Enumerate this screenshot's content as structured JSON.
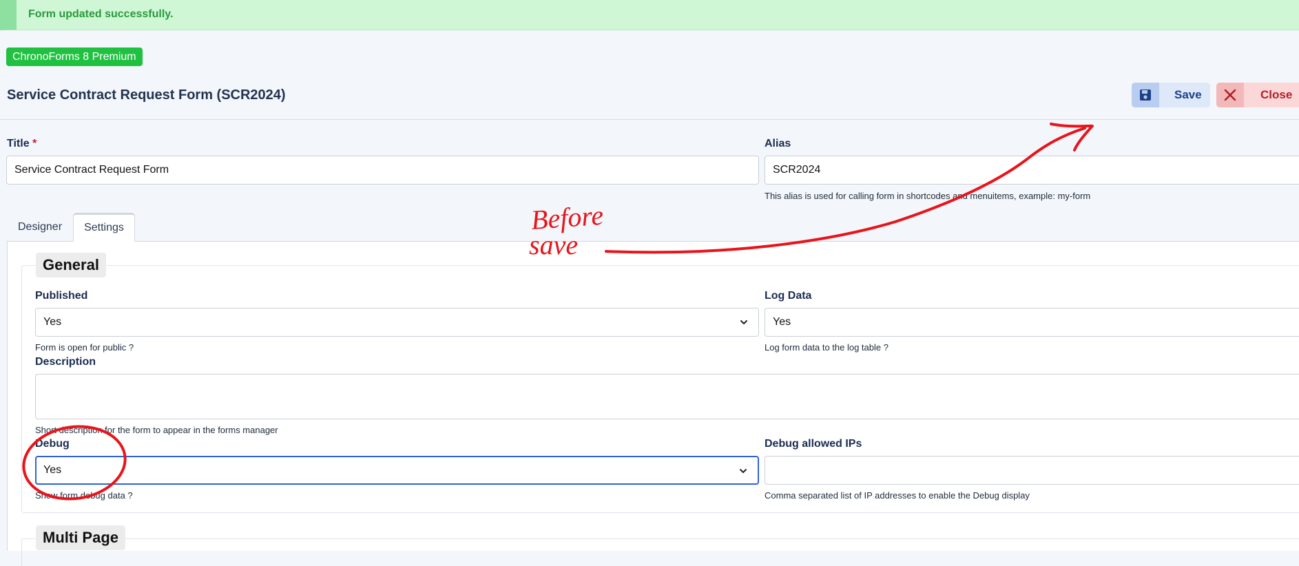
{
  "alert": {
    "message": "Form updated successfully."
  },
  "badge": {
    "label": "ChronoForms 8 Premium"
  },
  "header": {
    "title": "Service Contract Request Form (SCR2024)",
    "save_label": "Save",
    "close_label": "Close",
    "save_icon": "floppy-disk-icon",
    "close_icon": "x-icon"
  },
  "form": {
    "title_label": "Title",
    "title_required_mark": "*",
    "title_value": "Service Contract Request Form",
    "alias_label": "Alias",
    "alias_value": "SCR2024",
    "alias_hint": "This alias is used for calling form in shortcodes and menuitems, example: my-form"
  },
  "tabs": [
    {
      "label": "Designer",
      "active": false
    },
    {
      "label": "Settings",
      "active": true
    }
  ],
  "general": {
    "legend": "General",
    "published": {
      "label": "Published",
      "value": "Yes",
      "hint": "Form is open for public ?"
    },
    "log_data": {
      "label": "Log Data",
      "value": "Yes",
      "hint": "Log form data to the log table ?"
    },
    "description": {
      "label": "Description",
      "value": "",
      "hint": "Short description for the form to appear in the forms manager"
    },
    "debug": {
      "label": "Debug",
      "value": "Yes",
      "hint": "Show form debug data ?"
    },
    "debug_ips": {
      "label": "Debug allowed IPs",
      "value": "",
      "hint": "Comma separated list of IP addresses to enable the Debug display"
    }
  },
  "multipage": {
    "legend": "Multi Page"
  },
  "annotation": {
    "text_line1": "Before",
    "text_line2": "save",
    "color": "#e8141a"
  },
  "colors": {
    "accent": "#2f63d5",
    "success": "#20c141",
    "danger": "#b11f2a"
  }
}
